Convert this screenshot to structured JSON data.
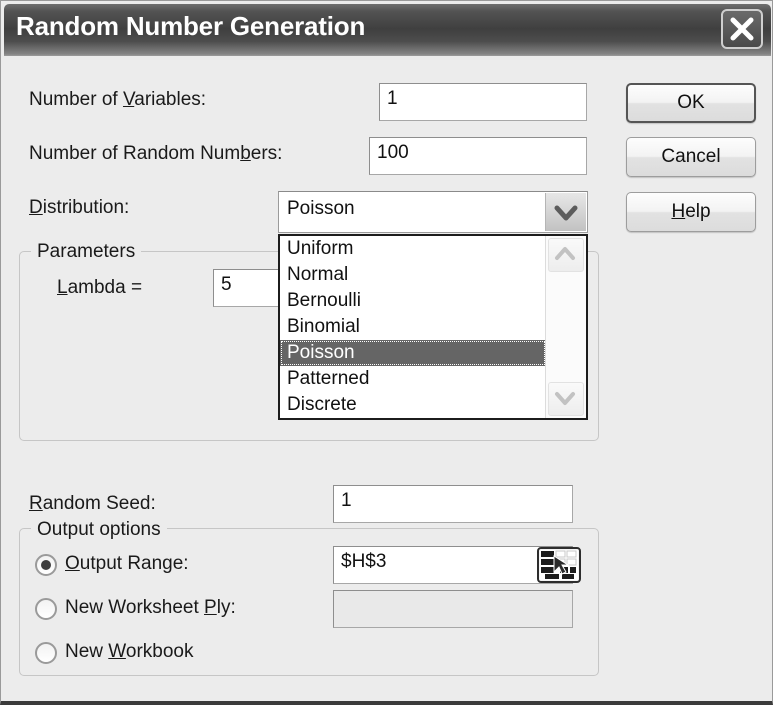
{
  "window": {
    "title": "Random Number Generation",
    "close_icon": "close-x-icon"
  },
  "fields": {
    "num_variables": {
      "label_pre": "Number of ",
      "label_accel": "V",
      "label_post": "ariables:",
      "value": "1"
    },
    "num_random_numbers": {
      "label_pre": "Number of Random Num",
      "label_accel": "b",
      "label_post": "ers:",
      "value": "100"
    },
    "distribution": {
      "label_pre": "",
      "label_accel": "D",
      "label_post": "istribution:",
      "value": "Poisson",
      "arrow_icon": "chevron-down-icon",
      "options": [
        "Uniform",
        "Normal",
        "Bernoulli",
        "Binomial",
        "Poisson",
        "Patterned",
        "Discrete"
      ],
      "selected_index": 4,
      "scroll_up_icon": "chevron-up-icon",
      "scroll_down_icon": "chevron-down-icon"
    },
    "random_seed": {
      "label_pre": "",
      "label_accel": "R",
      "label_post": "andom Seed:",
      "value": "1"
    }
  },
  "parameters_group": {
    "title": "Parameters",
    "lambda": {
      "label_pre": "",
      "label_accel": "L",
      "label_post": "ambda =",
      "value": "5"
    }
  },
  "output_group": {
    "title": "Output options",
    "options": [
      {
        "label_pre": "",
        "label_accel": "O",
        "label_post": "utput Range:",
        "selected": true,
        "value": "$H$3",
        "has_input": true,
        "input_disabled": false,
        "picker_icon": "range-select-icon"
      },
      {
        "label_pre": "New Worksheet ",
        "label_accel": "P",
        "label_post": "ly:",
        "selected": false,
        "value": "",
        "has_input": true,
        "input_disabled": true
      },
      {
        "label_pre": "New ",
        "label_accel": "W",
        "label_post": "orkbook",
        "selected": false,
        "has_input": false
      }
    ]
  },
  "buttons": {
    "ok": {
      "label_pre": "OK",
      "label_accel": "",
      "label_post": ""
    },
    "cancel": {
      "label_pre": "Cancel",
      "label_accel": "",
      "label_post": ""
    },
    "help": {
      "label_pre": "",
      "label_accel": "H",
      "label_post": "elp"
    }
  },
  "colors": {
    "dialog_bg": "#ececec",
    "titlebar_dark": "#3f3f3f",
    "highlight": "#656565",
    "text": "#1a1a1a"
  }
}
